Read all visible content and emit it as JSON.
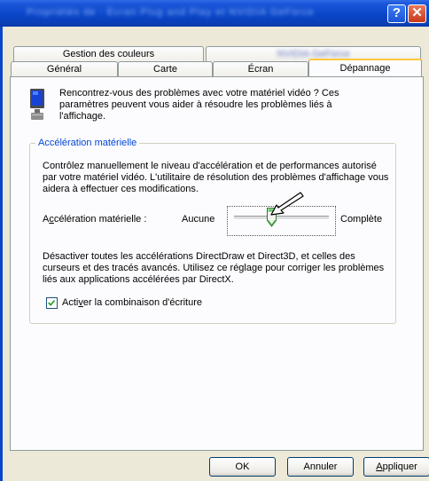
{
  "window": {
    "title": "Propriétés de : Écran Plug and Play et NVIDIA GeForce",
    "help_button": "?",
    "close_button": "✕"
  },
  "tabs": {
    "row1": [
      {
        "label": "Gestion des couleurs"
      },
      {
        "label": "NVIDIA GeForce"
      }
    ],
    "row2": [
      {
        "label": "Général"
      },
      {
        "label": "Carte"
      },
      {
        "label": "Écran"
      },
      {
        "label": "Dépannage",
        "active": true
      }
    ]
  },
  "panel": {
    "intro_text": "Rencontrez-vous des problèmes avec votre matériel vidéo ? Ces paramètres peuvent vous aider à résoudre les problèmes liés à l'affichage.",
    "group_title": "Accélération matérielle",
    "group_description": "Contrôlez manuellement le niveau d'accélération et de performances autorisé par votre matériel vidéo. L'utilitaire de résolution des problèmes d'affichage vous aidera à effectuer ces modifications.",
    "accel_label_prefix": "A",
    "accel_label_underlined": "c",
    "accel_label_suffix": "célération matérielle :",
    "slider_min_label": "Aucune",
    "slider_max_label": "Complète",
    "slider_level_fraction": 0.4,
    "level_description": "Désactiver toutes les accélérations DirectDraw et Direct3D, et celles des curseurs et des tracés avancés. Utilisez ce réglage pour corriger les problèmes liés aux applications accélérées par DirectX.",
    "checkbox_label_prefix": "Acti",
    "checkbox_label_underlined": "v",
    "checkbox_label_suffix": "er la combinaison d'écriture",
    "checkbox_checked": true
  },
  "buttons": {
    "ok": "OK",
    "cancel": "Annuler",
    "apply_underlined": "A",
    "apply_rest": "ppliquer"
  },
  "icons": {
    "monitor": "monitor-icon",
    "cursor": "arrow-cursor-icon"
  }
}
